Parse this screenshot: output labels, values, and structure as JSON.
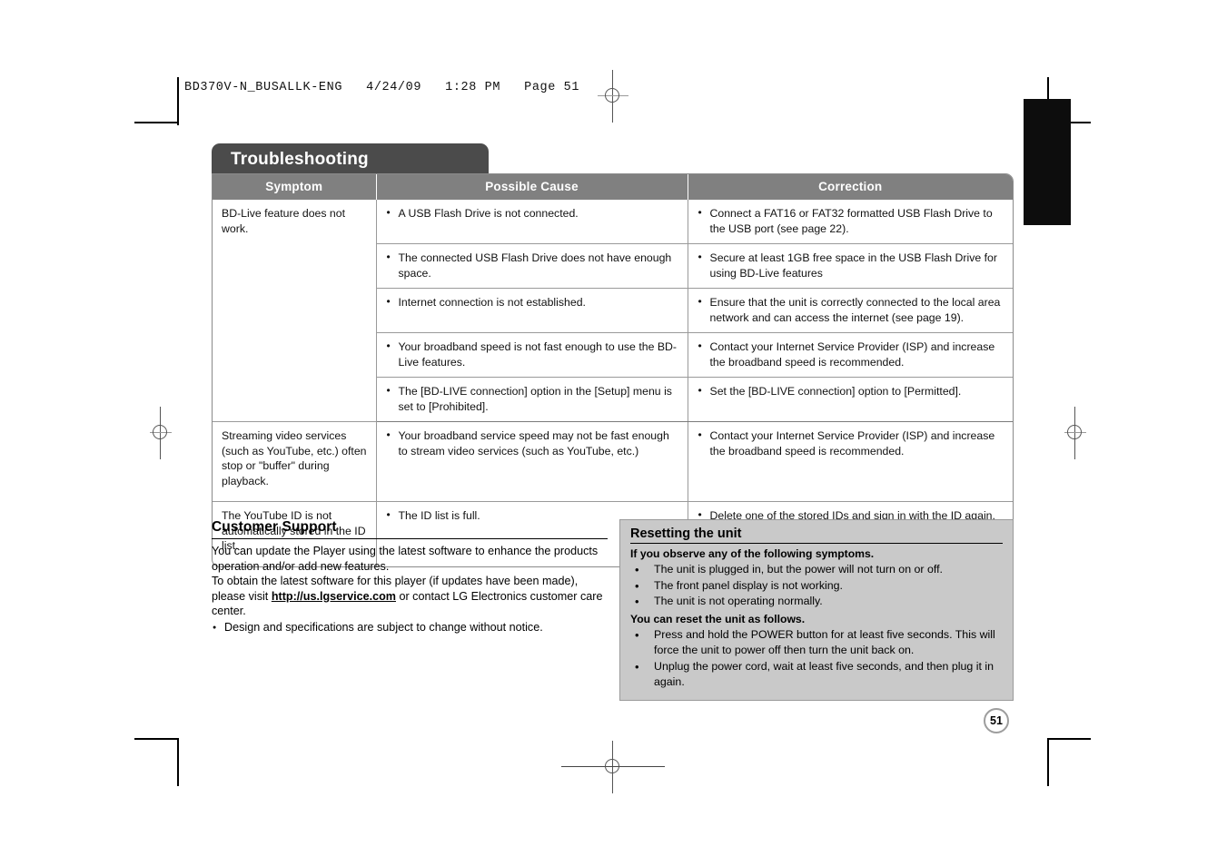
{
  "print_header": {
    "text": "BD370V-N_BUSALLK-ENG   4/24/09   1:28 PM   Page 51"
  },
  "section": {
    "title": "Troubleshooting"
  },
  "table": {
    "headers": [
      "Symptom",
      "Possible Cause",
      "Correction"
    ],
    "groups": [
      {
        "symptom": "BD-Live feature does not work.",
        "rows": [
          {
            "cause": "A USB Flash Drive is not connected.",
            "correction": "Connect a FAT16 or FAT32 formatted USB Flash Drive to the USB port (see page 22)."
          },
          {
            "cause": "The connected USB Flash Drive does not have enough space.",
            "correction": "Secure at least 1GB free space in the USB Flash Drive for using BD-Live features"
          },
          {
            "cause": "Internet connection is not established.",
            "correction": "Ensure that the unit is correctly connected to the local area network and can access the internet (see page 19)."
          },
          {
            "cause": "Your broadband speed is not fast enough to use the BD-Live features.",
            "correction": "Contact your Internet Service Provider (ISP) and increase the broadband speed is recommended."
          },
          {
            "cause": "The [BD-LIVE connection] option in the [Setup] menu is set to [Prohibited].",
            "correction": "Set the [BD-LIVE connection] option to [Permitted]."
          }
        ]
      },
      {
        "symptom": "Streaming video services (such as YouTube, etc.) often stop or \"buffer\" during playback.",
        "rows": [
          {
            "cause": "Your broadband service speed may not be fast enough to stream video services (such as YouTube, etc.)",
            "correction": "Contact your Internet Service Provider (ISP) and increase the broadband speed is recommended."
          }
        ]
      },
      {
        "symptom": "The YouTube ID is not automatically stored in the ID list.",
        "rows": [
          {
            "cause": "The ID list is full.",
            "correction": "Delete one of the stored IDs and sign in with the ID again."
          }
        ]
      }
    ]
  },
  "customer_support": {
    "heading": "Customer Support",
    "paragraph1": "You can update the Player using the latest software to enhance the products operation and/or add new features.",
    "paragraph2_part1": "To obtain the latest software for this player (if updates have been made), please visit ",
    "link": "http://us.lgservice.com",
    "paragraph2_part2": " or contact LG Electronics customer care center.",
    "bullet": "Design and specifications are subject to change without notice."
  },
  "resetting": {
    "heading": "Resetting the unit",
    "subhead1": "If you observe any of the following symptoms.",
    "symptoms": [
      "The unit is plugged in, but the power will not turn on or off.",
      "The front panel display is not working.",
      "The unit is not operating normally."
    ],
    "subhead2": "You can reset the unit as follows.",
    "steps": [
      "Press and hold the POWER button for at least five seconds. This will force the unit to power off then turn the unit back on.",
      "Unplug the power cord, wait at least five seconds, and then plug it in again."
    ]
  },
  "page_number": "51",
  "colors": {
    "section_tab": "#4b4b4b",
    "table_header": "#808080",
    "reset_box": "#c9c9c9",
    "thumb_tab": "#0d0d0d"
  }
}
